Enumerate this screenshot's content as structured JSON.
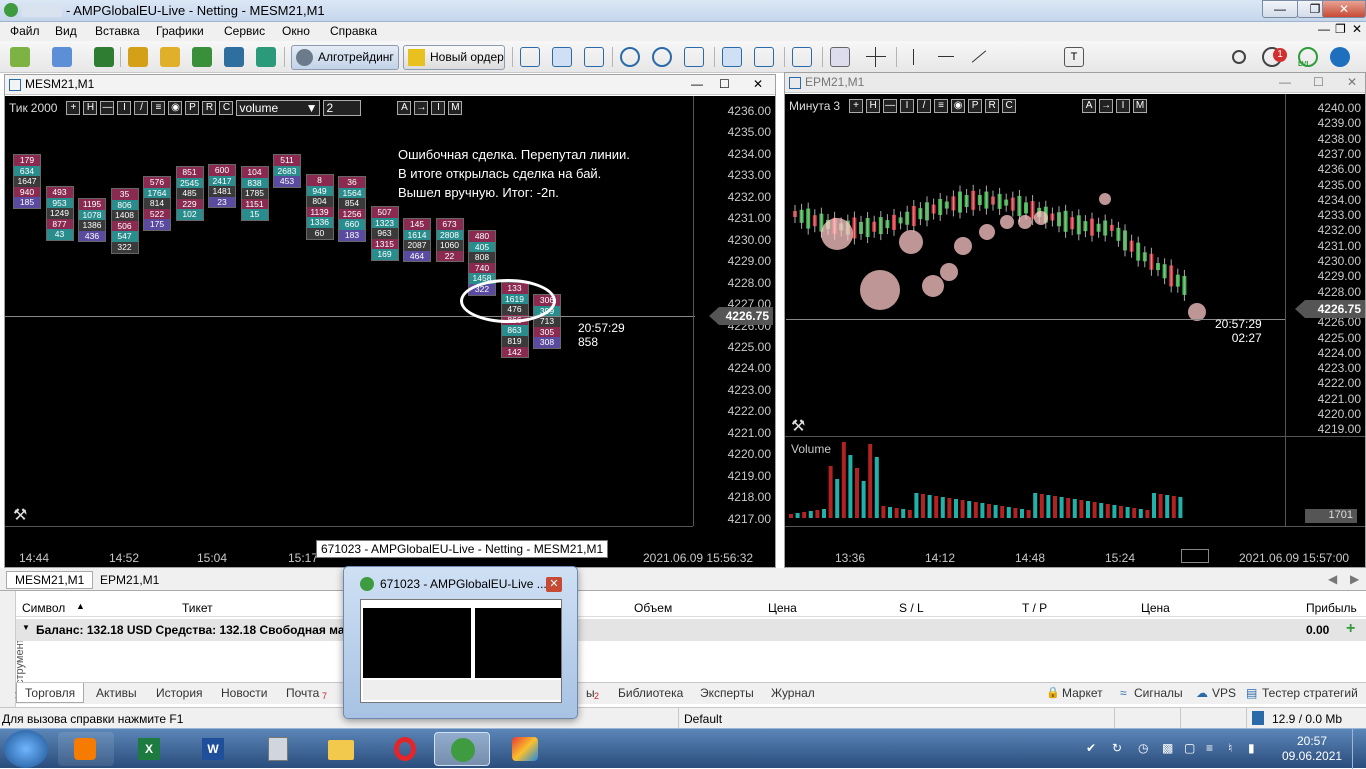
{
  "window": {
    "title": "- AMPGlobalEU-Live - Netting - MESM21,M1"
  },
  "menu": [
    "Файл",
    "Вид",
    "Вставка",
    "Графики",
    "Сервис",
    "Окно",
    "Справка"
  ],
  "toolbar": {
    "algo_label": "Алготрейдинг",
    "new_order_label": "Новый ордер",
    "notif_count": "1",
    "lvl_label": "LVL"
  },
  "chart1": {
    "title": "MESM21,M1",
    "panel_mode": "Тик",
    "panel_count": "2000",
    "panel_btns": [
      "+",
      "H",
      "—",
      "I",
      "/",
      "≡",
      "◉",
      "P",
      "R",
      "C"
    ],
    "indicator_select": "volume",
    "indicator_num": "2",
    "panel_btns2": [
      "A",
      "→",
      "I",
      "M"
    ],
    "annotation": [
      "Ошибочная сделка. Перепутал линии.",
      "В итоге открылась сделка на бай.",
      "Вышел вручную. Итог: -2п."
    ],
    "prices": [
      "4236.00",
      "4235.00",
      "4234.00",
      "4233.00",
      "4232.00",
      "4231.00",
      "4230.00",
      "4229.00",
      "4228.00",
      "4227.00",
      "4226.00",
      "4225.00",
      "4224.00",
      "4223.00",
      "4222.00",
      "4221.00",
      "4220.00",
      "4219.00",
      "4218.00",
      "4217.00"
    ],
    "current_price": "4226.75",
    "time_readout": "20:57:29",
    "vol_readout": "858",
    "time_labels": [
      "14:44",
      "14:52",
      "15:04",
      "15:17"
    ],
    "datetime": "2021.06.09 15:56:32",
    "footprint": [
      {
        "vals": [
          "179",
          "634",
          "1647",
          "940",
          "185"
        ]
      },
      {
        "vals": [
          "493",
          "953",
          "1249",
          "877",
          "43"
        ]
      },
      {
        "vals": [
          "1195",
          "1078",
          "1386",
          "436"
        ]
      },
      {
        "vals": [
          "35",
          "806",
          "1408",
          "506",
          "547",
          "322"
        ]
      },
      {
        "vals": [
          "576",
          "1764",
          "814",
          "522",
          "175"
        ]
      },
      {
        "vals": [
          "851",
          "2545",
          "485",
          "229",
          "102"
        ]
      },
      {
        "vals": [
          "600",
          "2417",
          "1481",
          "23"
        ]
      },
      {
        "vals": [
          "104",
          "838",
          "1785",
          "1151",
          "15"
        ]
      },
      {
        "vals": [
          "511",
          "2683",
          "453"
        ]
      },
      {
        "vals": [
          "8",
          "949",
          "804",
          "1139",
          "1336",
          "60"
        ]
      },
      {
        "vals": [
          "36",
          "1564",
          "854",
          "1256",
          "660",
          "183"
        ]
      },
      {
        "vals": [
          "507",
          "1323",
          "963",
          "1315",
          "169"
        ]
      },
      {
        "vals": [
          "145",
          "1614",
          "2087",
          "464"
        ]
      },
      {
        "vals": [
          "673",
          "2808",
          "1060",
          "22"
        ]
      },
      {
        "vals": [
          "480",
          "405",
          "808",
          "740",
          "1458",
          "322"
        ]
      },
      {
        "vals": [
          "133",
          "1619",
          "476",
          "866",
          "863",
          "819",
          "142"
        ]
      },
      {
        "vals": [
          "306",
          "399",
          "713",
          "305",
          "308"
        ]
      }
    ]
  },
  "chart2": {
    "title": "EPM21,M1",
    "panel_mode": "Минута",
    "panel_count": "3",
    "panel_btns": [
      "+",
      "H",
      "—",
      "I",
      "/",
      "≡",
      "◉",
      "P",
      "R",
      "C"
    ],
    "panel_btns2": [
      "A",
      "→",
      "I",
      "M"
    ],
    "prices": [
      "4240.00",
      "4239.00",
      "4238.00",
      "4237.00",
      "4236.00",
      "4235.00",
      "4234.00",
      "4233.00",
      "4232.00",
      "4231.00",
      "4230.00",
      "4229.00",
      "4228.00",
      "4227.00",
      "4226.00",
      "4225.00",
      "4224.00",
      "4223.00",
      "4222.00",
      "4221.00",
      "4220.00",
      "4219.00"
    ],
    "current_price": "4226.75",
    "time_readout": "20:57:29",
    "countdown": "02:27",
    "volume_label": "Volume",
    "volume_value": "1701",
    "time_labels": [
      "13:36",
      "14:12",
      "14:48",
      "15:24"
    ],
    "datetime": "2021.06.09 15:57:00"
  },
  "chart_tabs": [
    "MESM21,M1",
    "EPM21,M1"
  ],
  "terminal": {
    "side_label": "Инструменты",
    "columns": [
      "Символ",
      "Тикет",
      "Объем",
      "Цена",
      "S / L",
      "T / P",
      "Цена",
      "Прибыль"
    ],
    "balance_text": "Баланс: 132.18 USD  Средства: 132.18  Свободная маржа:",
    "profit": "0.00",
    "tabs": [
      "Торговля",
      "Активы",
      "История",
      "Новости",
      "Почта",
      "Библиотека",
      "Эксперты",
      "Журнал"
    ],
    "mail_count": "7",
    "hidden_tab_count": "2",
    "hidden_tab_suffix": "ы",
    "right_tabs": [
      "Маркет",
      "Сигналы",
      "VPS",
      "Тестер стратегий"
    ]
  },
  "tooltip": "671023 - AMPGlobalEU-Live - Netting - MESM21,M1",
  "popup_title": "671023 - AMPGlobalEU-Live ...",
  "status": {
    "help": "Для вызова справки нажмите F1",
    "profile": "Default",
    "traffic": "12.9 / 0.0 Mb"
  },
  "clock": {
    "time": "20:57",
    "date": "09.06.2021"
  }
}
